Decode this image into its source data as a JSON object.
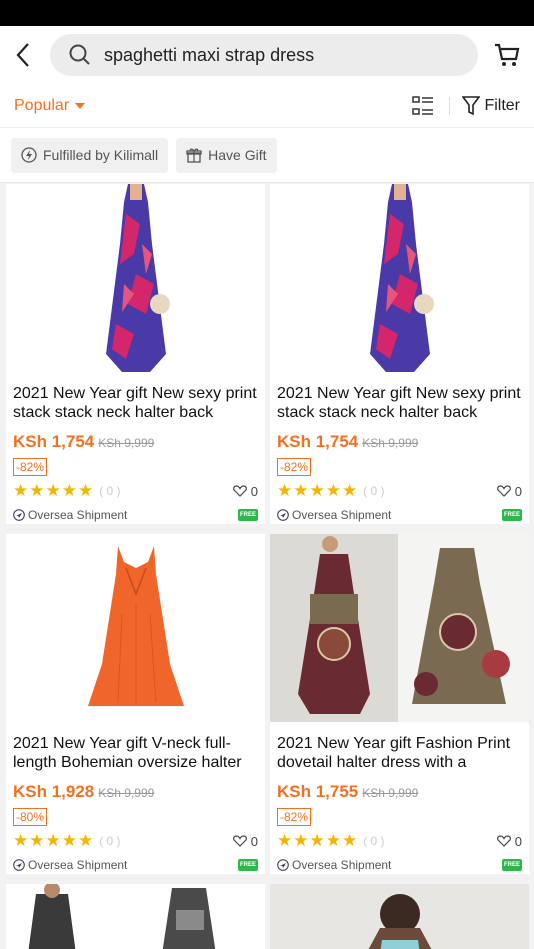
{
  "search": {
    "query": "spaghetti maxi strap dress"
  },
  "sort": {
    "label": "Popular"
  },
  "filter": {
    "label": "Filter"
  },
  "chips": [
    {
      "label": "Fulfilled by Kilimall"
    },
    {
      "label": "Have Gift"
    }
  ],
  "products": [
    {
      "title": "2021 New Year gift New sexy print stack stack neck halter back",
      "price": "KSh 1,754",
      "old_price": "KSh 9,999",
      "discount": "-82%",
      "rating_count": "( 0 )",
      "likes": "0",
      "shipping": "Oversea Shipment",
      "free_label": "FREE"
    },
    {
      "title": "2021 New Year gift New sexy print stack stack neck halter back",
      "price": "KSh 1,754",
      "old_price": "KSh 9,999",
      "discount": "-82%",
      "rating_count": "( 0 )",
      "likes": "0",
      "shipping": "Oversea Shipment",
      "free_label": "FREE"
    },
    {
      "title": "2021 New Year gift V-neck full-length Bohemian oversize halter",
      "price": "KSh 1,928",
      "old_price": "KSh 9,999",
      "discount": "-80%",
      "rating_count": "( 0 )",
      "likes": "0",
      "shipping": "Oversea Shipment",
      "free_label": "FREE"
    },
    {
      "title": "2021 New Year gift Fashion Print dovetail halter dress with a",
      "price": "KSh 1,755",
      "old_price": "KSh 9,999",
      "discount": "-82%",
      "rating_count": "( 0 )",
      "likes": "0",
      "shipping": "Oversea Shipment",
      "free_label": "FREE"
    }
  ],
  "stars": "★★★★★",
  "colors": {
    "accent": "#f37021",
    "star": "#f5b400",
    "free": "#2db84b"
  }
}
